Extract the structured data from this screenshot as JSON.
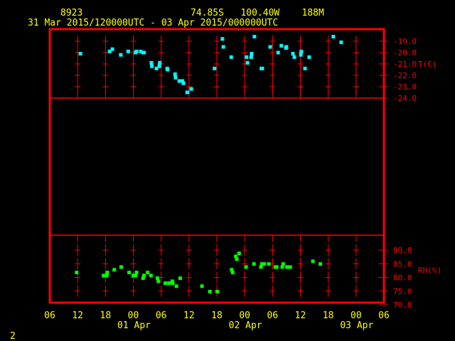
{
  "header": {
    "station": "8923",
    "location": "74.85S   100.40W    188M",
    "time_range": "31 Mar 2015/120000UTC - 03 Apr 2015/000000UTC"
  },
  "footer": {
    "frame_number": "2"
  },
  "colors": {
    "frame": "#ff0000",
    "text": "#ffff00",
    "temperature": "#00ffff",
    "rh": "#00ff00"
  },
  "chart_data": [
    {
      "type": "scatter",
      "title": "Temperature",
      "ylabel": "T(C)",
      "x_units": "hours since 31 Mar 2015 06 UTC",
      "xlim": [
        0,
        72
      ],
      "ylim": [
        -24,
        -19
      ],
      "yticks": [
        "-19.0",
        "-20.0",
        "-21.0",
        "-22.0",
        "-23.0",
        "-24.0"
      ],
      "ytick_values": [
        -19,
        -20,
        -21,
        -22,
        -23,
        -24
      ],
      "points": [
        [
          6.6,
          -20.1
        ],
        [
          12.9,
          -19.9
        ],
        [
          13.5,
          -19.7
        ],
        [
          15.3,
          -20.2
        ],
        [
          16.9,
          -19.9
        ],
        [
          18.5,
          -20.0
        ],
        [
          18.7,
          -19.9
        ],
        [
          19.6,
          -19.9
        ],
        [
          20.1,
          -20.0
        ],
        [
          20.3,
          -20.0
        ],
        [
          21.9,
          -20.9
        ],
        [
          22.0,
          -21.2
        ],
        [
          23.0,
          -21.4
        ],
        [
          23.6,
          -21.2
        ],
        [
          23.7,
          -20.9
        ],
        [
          25.3,
          -21.4
        ],
        [
          25.4,
          -21.5
        ],
        [
          27.0,
          -21.9
        ],
        [
          27.1,
          -22.2
        ],
        [
          27.9,
          -22.5
        ],
        [
          28.6,
          -22.5
        ],
        [
          28.8,
          -22.7
        ],
        [
          29.6,
          -23.5
        ],
        [
          29.7,
          -23.5
        ],
        [
          30.5,
          -23.2
        ],
        [
          35.5,
          -21.4
        ],
        [
          37.2,
          -18.8
        ],
        [
          37.4,
          -19.5
        ],
        [
          39.1,
          -20.4
        ],
        [
          42.4,
          -20.4
        ],
        [
          42.6,
          -20.9
        ],
        [
          43.4,
          -20.4
        ],
        [
          43.5,
          -20.1
        ],
        [
          44.1,
          -18.6
        ],
        [
          45.6,
          -21.4
        ],
        [
          45.8,
          -21.4
        ],
        [
          47.5,
          -19.5
        ],
        [
          49.2,
          -20.0
        ],
        [
          49.9,
          -19.4
        ],
        [
          50.9,
          -19.6
        ],
        [
          51.0,
          -19.5
        ],
        [
          52.4,
          -20.1
        ],
        [
          52.7,
          -20.4
        ],
        [
          54.1,
          -20.2
        ],
        [
          54.2,
          -19.9
        ],
        [
          55.0,
          -21.4
        ],
        [
          55.9,
          -20.4
        ],
        [
          61.1,
          -18.6
        ],
        [
          62.8,
          -19.1
        ]
      ]
    },
    {
      "type": "scatter",
      "title": "Relative Humidity",
      "ylabel": "RH(%)",
      "x_units": "hours since 31 Mar 2015 06 UTC",
      "xlim": [
        0,
        72
      ],
      "ylim": [
        70,
        90
      ],
      "yticks": [
        "90.0",
        "85.0",
        "80.0",
        "75.0",
        "70.0"
      ],
      "ytick_values": [
        90,
        85,
        80,
        75,
        70
      ],
      "points": [
        [
          5.8,
          81.8
        ],
        [
          11.6,
          80.7
        ],
        [
          12.3,
          80.7
        ],
        [
          12.4,
          81.8
        ],
        [
          13.9,
          82.8
        ],
        [
          15.4,
          83.8
        ],
        [
          17.1,
          81.8
        ],
        [
          18.0,
          80.7
        ],
        [
          18.5,
          80.7
        ],
        [
          18.7,
          81.8
        ],
        [
          20.1,
          79.7
        ],
        [
          20.3,
          80.7
        ],
        [
          21.1,
          81.8
        ],
        [
          21.8,
          80.7
        ],
        [
          23.2,
          79.7
        ],
        [
          23.4,
          78.6
        ],
        [
          24.9,
          77.9
        ],
        [
          25.7,
          77.9
        ],
        [
          26.4,
          78.6
        ],
        [
          26.5,
          77.9
        ],
        [
          27.3,
          76.8
        ],
        [
          28.1,
          79.7
        ],
        [
          32.8,
          76.8
        ],
        [
          34.5,
          74.8
        ],
        [
          36.1,
          74.8
        ],
        [
          39.2,
          82.8
        ],
        [
          39.4,
          81.8
        ],
        [
          40.1,
          87.7
        ],
        [
          40.3,
          86.7
        ],
        [
          40.8,
          88.8
        ],
        [
          42.3,
          83.8
        ],
        [
          44.0,
          84.9
        ],
        [
          45.5,
          83.8
        ],
        [
          45.7,
          84.9
        ],
        [
          46.2,
          84.9
        ],
        [
          47.2,
          84.9
        ],
        [
          48.6,
          83.8
        ],
        [
          48.9,
          83.8
        ],
        [
          50.1,
          83.8
        ],
        [
          50.3,
          84.9
        ],
        [
          51.1,
          83.8
        ],
        [
          51.8,
          83.8
        ],
        [
          56.7,
          85.9
        ],
        [
          58.3,
          84.9
        ]
      ]
    }
  ],
  "x_axis": {
    "tick_labels": [
      "06",
      "12",
      "18",
      "00",
      "06",
      "12",
      "18",
      "00",
      "06",
      "12",
      "18",
      "00",
      "06"
    ],
    "date_labels": [
      {
        "label": "01 Apr",
        "hour": 18
      },
      {
        "label": "02 Apr",
        "hour": 42
      },
      {
        "label": "03 Apr",
        "hour": 66
      }
    ]
  }
}
